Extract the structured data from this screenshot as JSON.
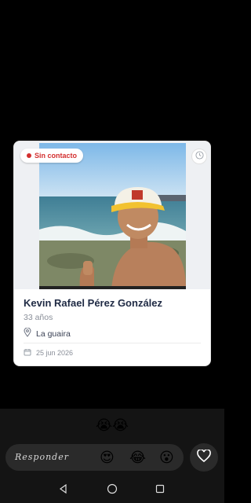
{
  "card": {
    "status_badge": "Sin contacto",
    "name": "Kevin Rafael Pérez González",
    "age": "33 años",
    "location": "La guaira",
    "date": "25 jun 2026",
    "status_color": "#d32f2f"
  },
  "reply_bar": {
    "placeholder": "Responder",
    "quick_reactions": "😭😭",
    "reactions": [
      "😍",
      "😂",
      "😮"
    ]
  },
  "icons": {
    "clock": "clock-icon",
    "location": "location-pin-icon",
    "calendar": "calendar-icon",
    "heart": "heart-icon",
    "back": "back-triangle-icon",
    "home": "home-circle-icon",
    "recents": "recents-square-icon"
  }
}
